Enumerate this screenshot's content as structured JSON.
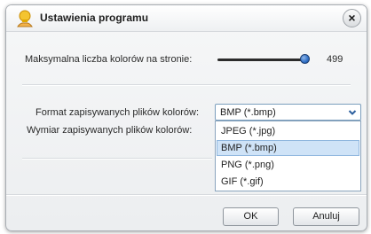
{
  "window": {
    "title": "Ustawienia programu",
    "close_label": "×",
    "icon": "lightbulb-hand-icon",
    "accent_color": "#2f6fc6"
  },
  "settings": {
    "max_colors": {
      "label": "Maksymalna liczba kolorów na stronie:",
      "value": "499",
      "slider_fraction": 1.0
    },
    "file_format": {
      "label": "Format zapisywanych plików kolorów:",
      "selected": "BMP (*.bmp)",
      "options": [
        "JPEG (*.jpg)",
        "BMP (*.bmp)",
        "PNG (*.png)",
        "GIF (*.gif)"
      ],
      "highlighted_index": 1
    },
    "file_dimensions": {
      "label": "Wymiar zapisywanych plików kolorów:"
    }
  },
  "buttons": {
    "ok": "OK",
    "cancel": "Anuluj"
  }
}
